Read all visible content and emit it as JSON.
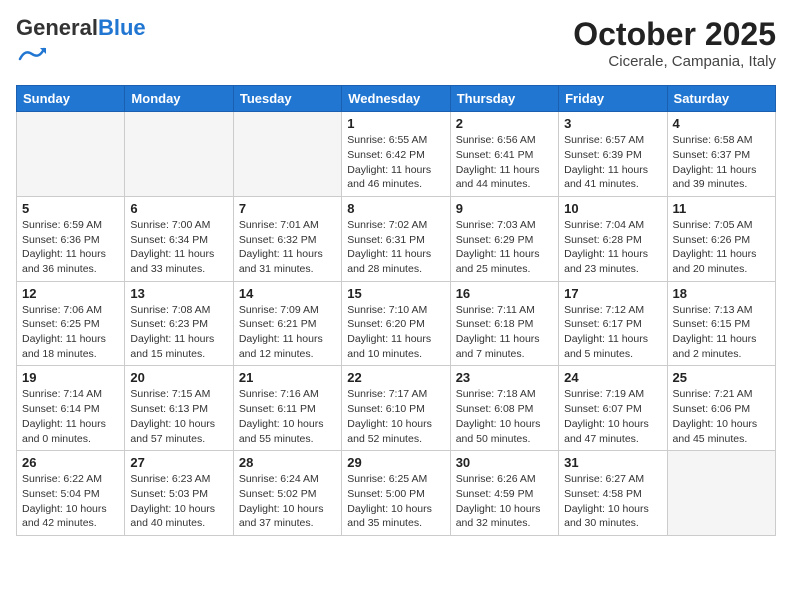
{
  "header": {
    "logo_general": "General",
    "logo_blue": "Blue",
    "month_title": "October 2025",
    "location": "Cicerale, Campania, Italy"
  },
  "weekdays": [
    "Sunday",
    "Monday",
    "Tuesday",
    "Wednesday",
    "Thursday",
    "Friday",
    "Saturday"
  ],
  "weeks": [
    [
      {
        "day": "",
        "info": ""
      },
      {
        "day": "",
        "info": ""
      },
      {
        "day": "",
        "info": ""
      },
      {
        "day": "1",
        "info": "Sunrise: 6:55 AM\nSunset: 6:42 PM\nDaylight: 11 hours\nand 46 minutes."
      },
      {
        "day": "2",
        "info": "Sunrise: 6:56 AM\nSunset: 6:41 PM\nDaylight: 11 hours\nand 44 minutes."
      },
      {
        "day": "3",
        "info": "Sunrise: 6:57 AM\nSunset: 6:39 PM\nDaylight: 11 hours\nand 41 minutes."
      },
      {
        "day": "4",
        "info": "Sunrise: 6:58 AM\nSunset: 6:37 PM\nDaylight: 11 hours\nand 39 minutes."
      }
    ],
    [
      {
        "day": "5",
        "info": "Sunrise: 6:59 AM\nSunset: 6:36 PM\nDaylight: 11 hours\nand 36 minutes."
      },
      {
        "day": "6",
        "info": "Sunrise: 7:00 AM\nSunset: 6:34 PM\nDaylight: 11 hours\nand 33 minutes."
      },
      {
        "day": "7",
        "info": "Sunrise: 7:01 AM\nSunset: 6:32 PM\nDaylight: 11 hours\nand 31 minutes."
      },
      {
        "day": "8",
        "info": "Sunrise: 7:02 AM\nSunset: 6:31 PM\nDaylight: 11 hours\nand 28 minutes."
      },
      {
        "day": "9",
        "info": "Sunrise: 7:03 AM\nSunset: 6:29 PM\nDaylight: 11 hours\nand 25 minutes."
      },
      {
        "day": "10",
        "info": "Sunrise: 7:04 AM\nSunset: 6:28 PM\nDaylight: 11 hours\nand 23 minutes."
      },
      {
        "day": "11",
        "info": "Sunrise: 7:05 AM\nSunset: 6:26 PM\nDaylight: 11 hours\nand 20 minutes."
      }
    ],
    [
      {
        "day": "12",
        "info": "Sunrise: 7:06 AM\nSunset: 6:25 PM\nDaylight: 11 hours\nand 18 minutes."
      },
      {
        "day": "13",
        "info": "Sunrise: 7:08 AM\nSunset: 6:23 PM\nDaylight: 11 hours\nand 15 minutes."
      },
      {
        "day": "14",
        "info": "Sunrise: 7:09 AM\nSunset: 6:21 PM\nDaylight: 11 hours\nand 12 minutes."
      },
      {
        "day": "15",
        "info": "Sunrise: 7:10 AM\nSunset: 6:20 PM\nDaylight: 11 hours\nand 10 minutes."
      },
      {
        "day": "16",
        "info": "Sunrise: 7:11 AM\nSunset: 6:18 PM\nDaylight: 11 hours\nand 7 minutes."
      },
      {
        "day": "17",
        "info": "Sunrise: 7:12 AM\nSunset: 6:17 PM\nDaylight: 11 hours\nand 5 minutes."
      },
      {
        "day": "18",
        "info": "Sunrise: 7:13 AM\nSunset: 6:15 PM\nDaylight: 11 hours\nand 2 minutes."
      }
    ],
    [
      {
        "day": "19",
        "info": "Sunrise: 7:14 AM\nSunset: 6:14 PM\nDaylight: 11 hours\nand 0 minutes."
      },
      {
        "day": "20",
        "info": "Sunrise: 7:15 AM\nSunset: 6:13 PM\nDaylight: 10 hours\nand 57 minutes."
      },
      {
        "day": "21",
        "info": "Sunrise: 7:16 AM\nSunset: 6:11 PM\nDaylight: 10 hours\nand 55 minutes."
      },
      {
        "day": "22",
        "info": "Sunrise: 7:17 AM\nSunset: 6:10 PM\nDaylight: 10 hours\nand 52 minutes."
      },
      {
        "day": "23",
        "info": "Sunrise: 7:18 AM\nSunset: 6:08 PM\nDaylight: 10 hours\nand 50 minutes."
      },
      {
        "day": "24",
        "info": "Sunrise: 7:19 AM\nSunset: 6:07 PM\nDaylight: 10 hours\nand 47 minutes."
      },
      {
        "day": "25",
        "info": "Sunrise: 7:21 AM\nSunset: 6:06 PM\nDaylight: 10 hours\nand 45 minutes."
      }
    ],
    [
      {
        "day": "26",
        "info": "Sunrise: 6:22 AM\nSunset: 5:04 PM\nDaylight: 10 hours\nand 42 minutes."
      },
      {
        "day": "27",
        "info": "Sunrise: 6:23 AM\nSunset: 5:03 PM\nDaylight: 10 hours\nand 40 minutes."
      },
      {
        "day": "28",
        "info": "Sunrise: 6:24 AM\nSunset: 5:02 PM\nDaylight: 10 hours\nand 37 minutes."
      },
      {
        "day": "29",
        "info": "Sunrise: 6:25 AM\nSunset: 5:00 PM\nDaylight: 10 hours\nand 35 minutes."
      },
      {
        "day": "30",
        "info": "Sunrise: 6:26 AM\nSunset: 4:59 PM\nDaylight: 10 hours\nand 32 minutes."
      },
      {
        "day": "31",
        "info": "Sunrise: 6:27 AM\nSunset: 4:58 PM\nDaylight: 10 hours\nand 30 minutes."
      },
      {
        "day": "",
        "info": ""
      }
    ]
  ]
}
